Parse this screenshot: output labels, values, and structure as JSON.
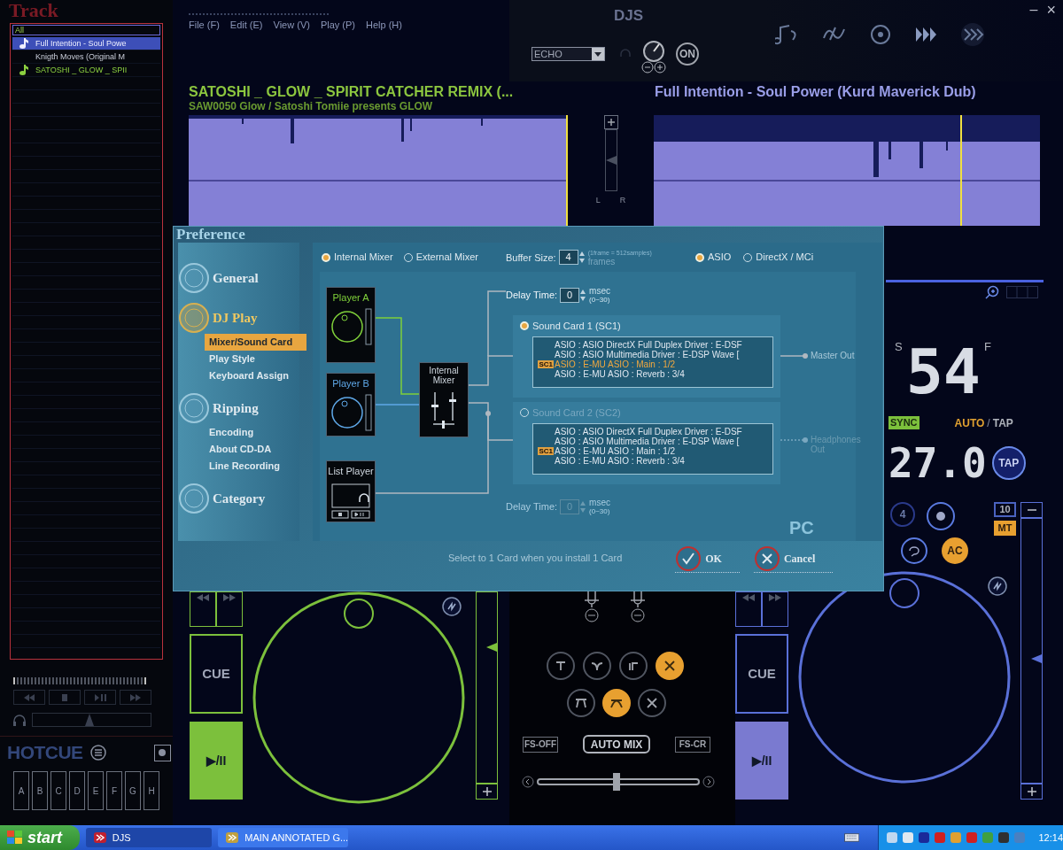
{
  "app": {
    "title": "DJS",
    "menu": [
      "File (F)",
      "Edit (E)",
      "View (V)",
      "Play (P)",
      "Help (H)"
    ],
    "minimize": "–",
    "close": "×"
  },
  "track_panel": {
    "title": "Track",
    "filter": "All",
    "tracks": [
      {
        "title": "Full Intention - Soul Powe",
        "color": "#f0f0ff",
        "selected": true
      },
      {
        "title": "Knigth Moves (Original M",
        "selected": false
      },
      {
        "title": "SATOSHI _ GLOW _ SPII",
        "color": "#8cd040",
        "selected": false
      }
    ]
  },
  "monitor": {
    "level": 0.48
  },
  "hotcue": {
    "title": "HOTCUE",
    "keys": [
      "A",
      "B",
      "C",
      "D",
      "E",
      "F",
      "G",
      "H"
    ]
  },
  "effect": {
    "name": "ECHO",
    "power": "ON"
  },
  "deck_a": {
    "title": "SATOSHI _ GLOW _ SPIRIT CATCHER REMIX (...",
    "artist": "SAW0050 Glow / Satoshi Tomiie presents GLOW",
    "cue": "CUE",
    "play": "▶/II",
    "pitch": {
      "level": 0.71
    }
  },
  "center_strip": {
    "left": "L",
    "right": "R",
    "level": 0.5
  },
  "deck_b": {
    "title": "Full Intention - Soul Power (Kurd Maverick Dub)",
    "time_left": "S",
    "time": "54",
    "time_right": "F",
    "sync": "SYNC",
    "auto": "AUTO",
    "separator": "/",
    "tap_mode": "TAP",
    "bpm": "27.0",
    "tap": "TAP",
    "cue_number": "4",
    "pitch_range": "10",
    "mt": "MT",
    "ac": "AC",
    "cue": "CUE",
    "play": "▶/II",
    "pitch": {
      "level": 0.47
    }
  },
  "mixer": {
    "effect_rows": [
      [
        {
          "selected": false
        },
        {
          "selected": false
        },
        {
          "selected": false
        },
        {
          "selected": true
        }
      ],
      [
        {
          "selected": false
        },
        {
          "selected": true
        },
        {
          "selected": false
        }
      ]
    ],
    "fs_off": "FS-OFF",
    "auto_mix": "AUTO MIX",
    "fs_cr": "FS-CR",
    "crossfader": {
      "level": 0.49
    }
  },
  "preference": {
    "title": "Preference",
    "nav": [
      {
        "label": "General",
        "selected": false
      },
      {
        "label": "DJ Play",
        "selected": true,
        "children": [
          {
            "label": "Mixer/Sound Card",
            "selected": true
          },
          {
            "label": "Play Style",
            "selected": false
          },
          {
            "label": "Keyboard Assign",
            "selected": false
          }
        ]
      },
      {
        "label": "Ripping",
        "selected": false,
        "children": [
          {
            "label": "Encoding",
            "selected": false
          },
          {
            "label": "About CD-DA",
            "selected": false
          },
          {
            "label": "Line Recording",
            "selected": false
          }
        ]
      },
      {
        "label": "Category",
        "selected": false
      }
    ],
    "mixer_modes": [
      {
        "label": "Internal Mixer",
        "selected": true
      },
      {
        "label": "External Mixer",
        "selected": false
      }
    ],
    "buffer": {
      "label": "Buffer Size:",
      "value": "4",
      "note": "(1frame = 512samples)",
      "unit": "frames"
    },
    "drivers": [
      {
        "label": "ASIO",
        "selected": true
      },
      {
        "label": "DirectX / MCi",
        "selected": false
      }
    ],
    "delays": [
      {
        "label": "Delay Time:",
        "value": "0",
        "unit": "msec",
        "range": "(0~30)",
        "disabled": false
      },
      {
        "label": "Delay Time:",
        "value": "0",
        "unit": "msec",
        "range": "(0~30)",
        "disabled": true
      }
    ],
    "players": [
      {
        "label": "Player A",
        "kind": "deck",
        "color": "#7fd03a"
      },
      {
        "label": "Player B",
        "kind": "deck",
        "color": "#5fa8e8"
      },
      {
        "label": "List Player",
        "kind": "list"
      }
    ],
    "mixer_label": "Internal Mixer",
    "sound_cards": [
      {
        "label": "Sound Card 1 (SC1)",
        "selected": true,
        "output": "Master Out",
        "entries": [
          {
            "text": "ASIO : ASIO DirectX Full Duplex Driver : E-DSF",
            "selected": false
          },
          {
            "text": "ASIO : ASIO Multimedia Driver : E-DSP Wave [",
            "selected": false
          },
          {
            "text": "ASIO : E-MU ASIO : Main : 1/2",
            "tag": "SC1",
            "selected": true
          },
          {
            "text": "ASIO : E-MU ASIO : Reverb : 3/4",
            "selected": false
          }
        ]
      },
      {
        "label": "Sound Card 2 (SC2)",
        "selected": false,
        "output": "Headphones Out",
        "entries": [
          {
            "text": "ASIO : ASIO DirectX Full Duplex Driver : E-DSF",
            "selected": false
          },
          {
            "text": "ASIO : ASIO Multimedia Driver : E-DSP Wave [",
            "selected": false
          },
          {
            "text": "ASIO : E-MU ASIO : Main : 1/2",
            "tag": "SC1",
            "selected": false
          },
          {
            "text": "ASIO : E-MU ASIO : Reverb : 3/4",
            "selected": false
          }
        ]
      }
    ],
    "side_label": "PC",
    "hint": "Select to 1 Card when you install 1 Card",
    "ok": "OK",
    "cancel": "Cancel"
  },
  "taskbar": {
    "start": "start",
    "tasks": [
      {
        "label": "DJS",
        "selected": true
      },
      {
        "label": "MAIN ANNOTATED G...",
        "selected": false
      }
    ],
    "clock": "12:14"
  }
}
